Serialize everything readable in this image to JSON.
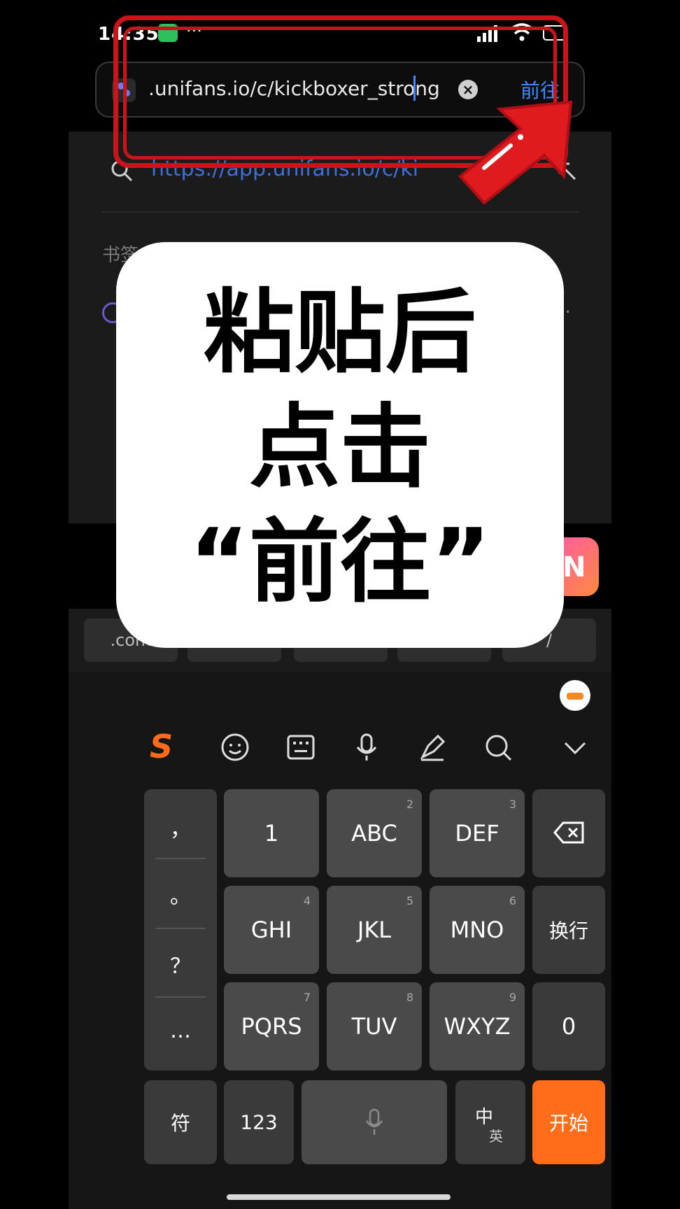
{
  "status_bar": {
    "time": "14:35",
    "more": "···"
  },
  "url_bar": {
    "value": ".unifans.io/c/kickboxer_strong",
    "clear_icon": "×",
    "go_label": "前往"
  },
  "suggestion": {
    "url": "https://app.unifans.io/c/ki",
    "section_label": "书签/历",
    "more": "…"
  },
  "shortcuts": [
    ".com",
    "",
    "",
    "",
    "/"
  ],
  "keyboard": {
    "punctuation": [
      "，",
      "。",
      "？",
      "…"
    ],
    "rows": [
      [
        {
          "label": "1",
          "num": ""
        },
        {
          "label": "ABC",
          "num": "2"
        },
        {
          "label": "DEF",
          "num": "3"
        }
      ],
      [
        {
          "label": "GHI",
          "num": "4"
        },
        {
          "label": "JKL",
          "num": "5"
        },
        {
          "label": "MNO",
          "num": "6"
        }
      ],
      [
        {
          "label": "PQRS",
          "num": "7"
        },
        {
          "label": "TUV",
          "num": "8"
        },
        {
          "label": "WXYZ",
          "num": "9"
        }
      ]
    ],
    "newline_label": "换行",
    "zero_label": "0",
    "symbol_label": "符",
    "num_switch_label": "123",
    "lang_switch_main": "中",
    "lang_switch_sub": "英",
    "enter_label": "开始"
  },
  "overlay": {
    "line1": "粘贴后",
    "line2": "点击",
    "line3": "“前往”"
  },
  "colors": {
    "highlight": "#c91419",
    "accent_blue": "#3d8bff",
    "enter_orange": "#ff6d1b"
  }
}
